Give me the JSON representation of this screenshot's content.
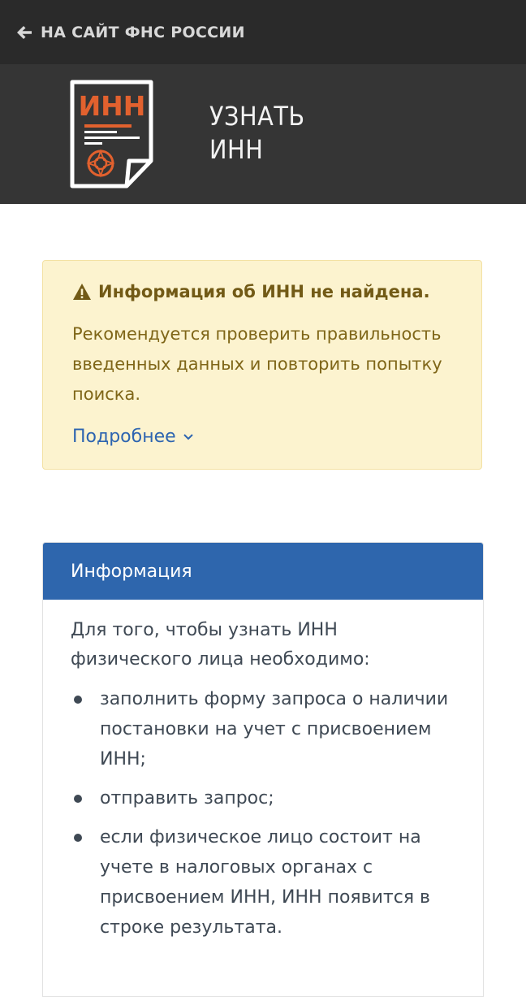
{
  "topbar": {
    "back_label": "НА САЙТ ФНС РОССИИ",
    "back_icon": "arrow-left-icon"
  },
  "header": {
    "logo_text": "ИНН",
    "title_line1": "УЗНАТЬ",
    "title_line2": "ИНН",
    "logo_icon": "document-icon",
    "colors": {
      "logo_accent": "#e2612e",
      "background": "#353535"
    }
  },
  "alert": {
    "icon": "warning-icon",
    "heading": "Информация об ИНН не найдена.",
    "text": "Рекомендуется проверить правильность введенных данных и повторить попытку поиска.",
    "more_label": "Подробнее",
    "more_icon": "chevron-down-icon",
    "colors": {
      "background": "#fcf3cf",
      "text": "#7f6618",
      "link": "#2d64b0"
    }
  },
  "info_panel": {
    "heading": "Информация",
    "intro": "Для того, чтобы узнать ИНН физического лица необходимо:",
    "items": [
      "заполнить форму запроса о наличии постановки на учет с присвоением ИНН;",
      "отправить запрос;",
      "если физическое лицо состоит на учете в налоговых органах с присвоением ИНН, ИНН появится в строке результата."
    ],
    "colors": {
      "header_bg": "#2e66ad"
    }
  }
}
